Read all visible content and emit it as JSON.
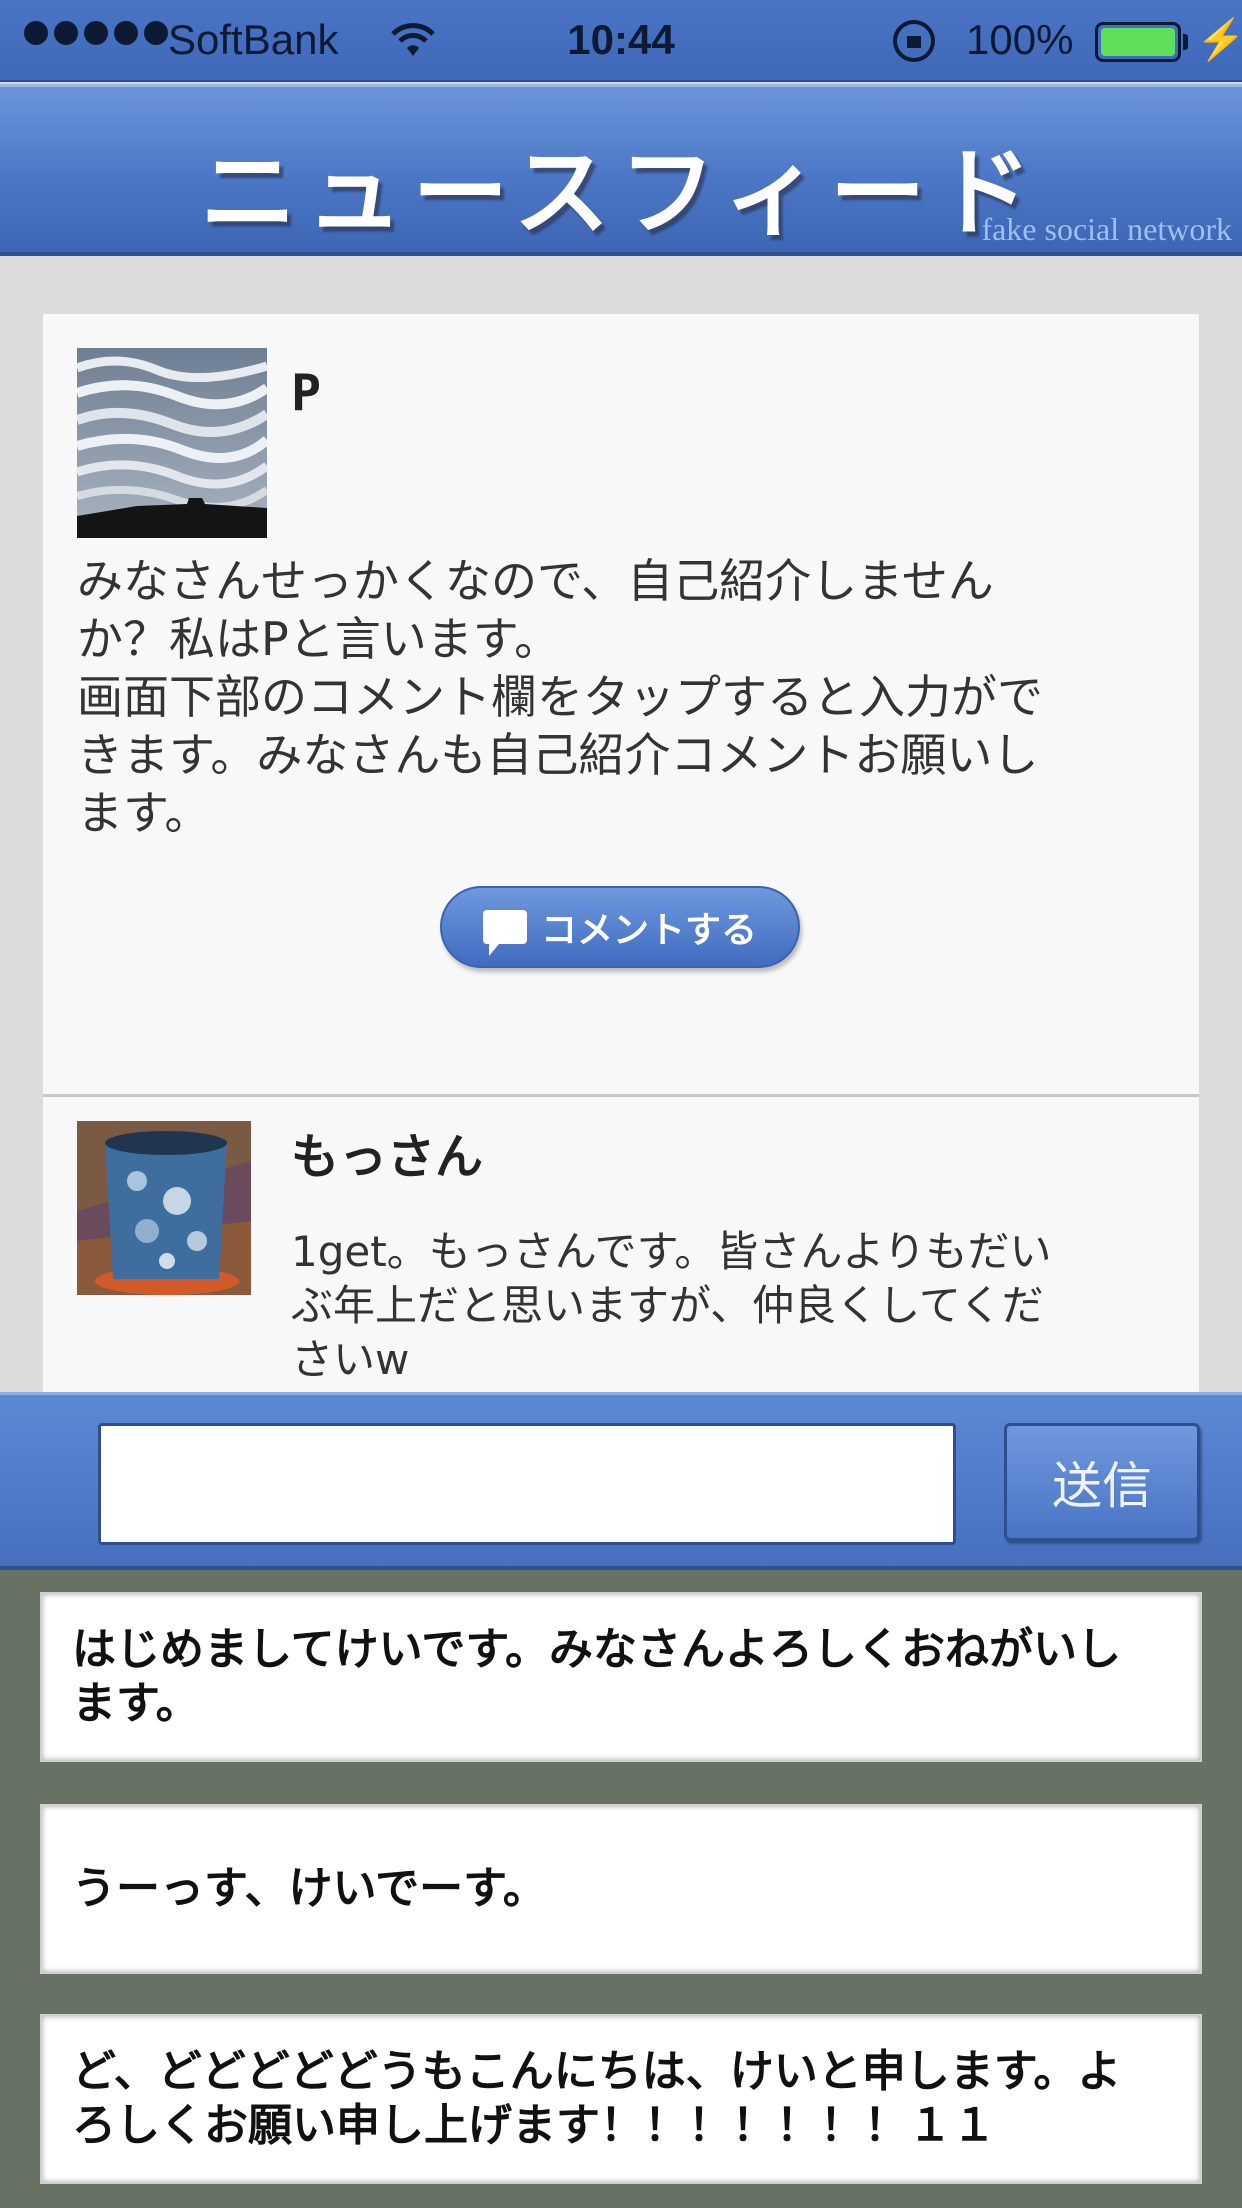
{
  "status_bar": {
    "carrier": "SoftBank",
    "time": "10:44",
    "battery_percent": "100%",
    "battery_color": "#5ee05a"
  },
  "header": {
    "title": "ニュースフィード",
    "tagline": "fake social network"
  },
  "post": {
    "author": "P",
    "avatar_icon": "cloudy-sky-photo",
    "body_lines": [
      "みなさんせっかくなので、自己紹介しません",
      "か？私はPと言います。",
      "画面下部のコメント欄をタップすると入力がで",
      "きます。みなさんも自己紹介コメントお願いし",
      "ます。"
    ],
    "comment_button_label": "コメントする"
  },
  "reply": {
    "author": "もっさん",
    "avatar_icon": "teacup-photo",
    "text_lines": [
      "1get。もっさんです。皆さんよりもだい",
      "ぶ年上だと思いますが、仲良くしてくだ",
      "さいw"
    ]
  },
  "input_bar": {
    "placeholder": "",
    "send_label": "送信"
  },
  "suggestions": [
    {
      "lines": [
        "はじめましてけいです。みなさんよろしくおねがいし",
        "ます。"
      ]
    },
    {
      "lines": [
        "うーっす、けいでーす。"
      ]
    },
    {
      "lines": [
        "ど、どどどどどうもこんにちは、けいと申します。よ",
        "ろしくお願い申し上げます！！！！！！！１１"
      ]
    }
  ],
  "colors": {
    "accent_blue": "#4b77c6",
    "suggestion_panel": "#677164"
  }
}
